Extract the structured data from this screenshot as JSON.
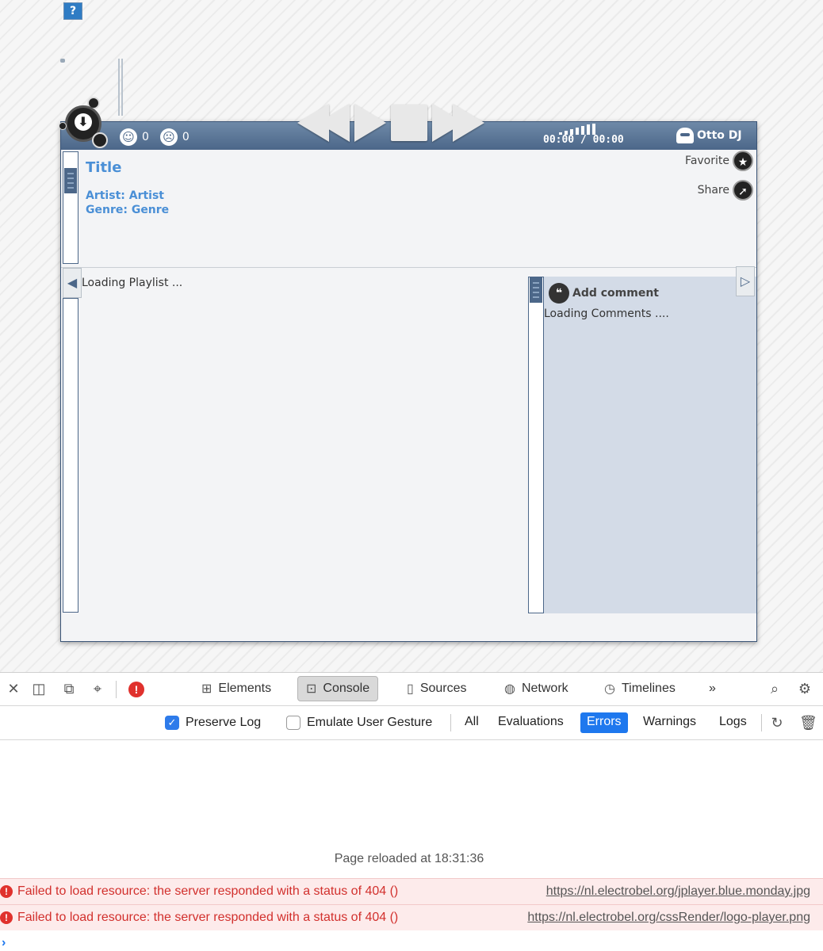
{
  "page": {
    "broken_image_glyph": "?"
  },
  "player": {
    "votes": {
      "likes": "0",
      "dislikes": "0"
    },
    "time": "00:00 / 00:00",
    "user": "Otto DJ",
    "track": {
      "title": "Title",
      "artist": "Artist: Artist",
      "genre": "Genre: Genre"
    },
    "favorite_label": "Favorite",
    "share_label": "Share",
    "playlist_loading": "Loading Playlist ...",
    "add_comment_label": "Add comment",
    "comments_loading": "Loading Comments ....",
    "icons": [
      "download-icon",
      "smile-icon",
      "frown-icon",
      "rewind-icon",
      "play-icon",
      "stop-icon",
      "forward-icon",
      "volume-icon",
      "user-icon",
      "star-icon",
      "share-icon",
      "quote-icon",
      "chevron-left-icon",
      "chevron-right-icon"
    ]
  },
  "devtools": {
    "tabs": [
      {
        "label": "Elements"
      },
      {
        "label": "Console"
      },
      {
        "label": "Sources"
      },
      {
        "label": "Network"
      },
      {
        "label": "Timelines"
      }
    ],
    "more_tabs": "»",
    "filters": {
      "preserve_log": "Preserve Log",
      "emulate_gesture": "Emulate User Gesture",
      "all": "All",
      "evaluations": "Evaluations",
      "errors": "Errors",
      "warnings": "Warnings",
      "logs": "Logs"
    },
    "preserve_log_checked": true,
    "emulate_gesture_checked": false,
    "active_tab": "Console",
    "active_filter": "Errors",
    "reloaded_text": "Page reloaded at 18:31:36",
    "errors": [
      {
        "message": "Failed to load resource: the server responded with a status of 404 ()",
        "url": "https://nl.electrobel.org/jplayer.blue.monday.jpg"
      },
      {
        "message": "Failed to load resource: the server responded with a status of 404 ()",
        "url": "https://nl.electrobel.org/cssRender/logo-player.png"
      }
    ],
    "prompt_glyph": "›",
    "colors": {
      "error": "#d2302d",
      "accent": "#1e78ee",
      "player_bar": "#4c6789",
      "track_text": "#4a8fd6"
    }
  }
}
